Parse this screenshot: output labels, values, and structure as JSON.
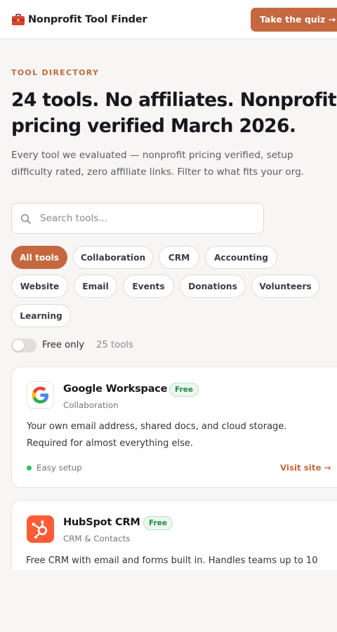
{
  "header": {
    "brand_name": "Nonprofit Tool Finder",
    "brand_icon": "toolbox-icon",
    "quiz_label": "Take the quiz →"
  },
  "hero": {
    "eyebrow": "TOOL DIRECTORY",
    "headline_line1": "24 tools. No affiliates. Nonprofit",
    "headline_line2": "pricing verified March 2026.",
    "subhead_line1": "Every tool we evaluated — nonprofit pricing verified, setup",
    "subhead_line2": "difficulty rated, zero affiliate links. Filter to what fits your org."
  },
  "search": {
    "placeholder": "Search tools...",
    "value": ""
  },
  "filters": [
    {
      "label": "All tools",
      "active": true
    },
    {
      "label": "Collaboration",
      "active": false
    },
    {
      "label": "CRM",
      "active": false
    },
    {
      "label": "Accounting",
      "active": false
    },
    {
      "label": "Website",
      "active": false
    },
    {
      "label": "Email",
      "active": false
    },
    {
      "label": "Events",
      "active": false
    },
    {
      "label": "Donations",
      "active": false
    },
    {
      "label": "Volunteers",
      "active": false
    },
    {
      "label": "Learning",
      "active": false
    }
  ],
  "free_toggle": {
    "label": "Free only",
    "on": false,
    "count_text": "25 tools"
  },
  "tools": [
    {
      "name": "Google Workspace",
      "badge": "Free",
      "category": "Collaboration",
      "desc_line1": "Your own email address, shared docs, and cloud storage.",
      "desc_line2": "Required for almost everything else.",
      "setup": "Easy setup",
      "visit_label": "Visit site →",
      "logo_icon": "google-logo-icon"
    },
    {
      "name": "HubSpot CRM",
      "badge": "Free",
      "category": "CRM & Contacts",
      "desc_line1": "Free CRM with email and forms built in. Handles teams up to 10",
      "logo_icon": "hubspot-logo-icon",
      "logo_color": "#ff5c35"
    }
  ],
  "colors": {
    "accent": "#c5673f",
    "success": "#27c05a",
    "background": "#f7f6f4"
  }
}
